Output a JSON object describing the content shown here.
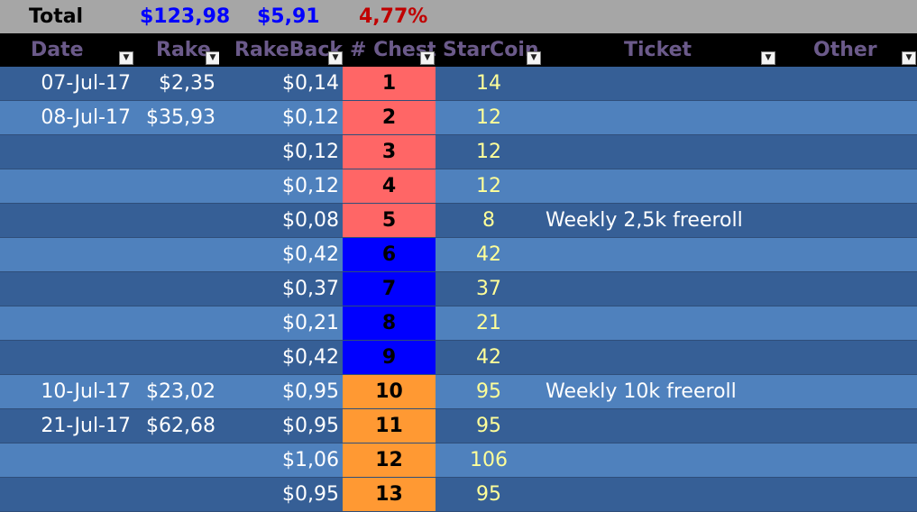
{
  "totals": {
    "label": "Total",
    "rake": "$123,98",
    "rakeback": "$5,91",
    "percent": "4,77%",
    "rake_color": "#0000ff",
    "rakeback_color": "#0000ff",
    "percent_color": "#c00000"
  },
  "columns": [
    {
      "key": "date",
      "label": "Date"
    },
    {
      "key": "rake",
      "label": "Rake"
    },
    {
      "key": "rakeback",
      "label": "RakeBack"
    },
    {
      "key": "chest",
      "label": "# Chest"
    },
    {
      "key": "starcoin",
      "label": "StarCoin"
    },
    {
      "key": "ticket",
      "label": "Ticket"
    },
    {
      "key": "other",
      "label": "Other"
    }
  ],
  "filter_icon": "dropdown-arrow-icon",
  "chest_colors": {
    "red": "#ff6666",
    "blue": "#0000ff",
    "orange": "#ff9933"
  },
  "rows": [
    {
      "date": "07-Jul-17",
      "rake": "$2,35",
      "rakeback": "$0,14",
      "chest": "1",
      "chest_color": "red",
      "starcoin": "14",
      "ticket": "",
      "other": ""
    },
    {
      "date": "08-Jul-17",
      "rake": "$35,93",
      "rakeback": "$0,12",
      "chest": "2",
      "chest_color": "red",
      "starcoin": "12",
      "ticket": "",
      "other": ""
    },
    {
      "date": "",
      "rake": "",
      "rakeback": "$0,12",
      "chest": "3",
      "chest_color": "red",
      "starcoin": "12",
      "ticket": "",
      "other": ""
    },
    {
      "date": "",
      "rake": "",
      "rakeback": "$0,12",
      "chest": "4",
      "chest_color": "red",
      "starcoin": "12",
      "ticket": "",
      "other": ""
    },
    {
      "date": "",
      "rake": "",
      "rakeback": "$0,08",
      "chest": "5",
      "chest_color": "red",
      "starcoin": "8",
      "ticket": "Weekly 2,5k freeroll",
      "other": ""
    },
    {
      "date": "",
      "rake": "",
      "rakeback": "$0,42",
      "chest": "6",
      "chest_color": "blue",
      "starcoin": "42",
      "ticket": "",
      "other": ""
    },
    {
      "date": "",
      "rake": "",
      "rakeback": "$0,37",
      "chest": "7",
      "chest_color": "blue",
      "starcoin": "37",
      "ticket": "",
      "other": ""
    },
    {
      "date": "",
      "rake": "",
      "rakeback": "$0,21",
      "chest": "8",
      "chest_color": "blue",
      "starcoin": "21",
      "ticket": "",
      "other": ""
    },
    {
      "date": "",
      "rake": "",
      "rakeback": "$0,42",
      "chest": "9",
      "chest_color": "blue",
      "starcoin": "42",
      "ticket": "",
      "other": ""
    },
    {
      "date": "10-Jul-17",
      "rake": "$23,02",
      "rakeback": "$0,95",
      "chest": "10",
      "chest_color": "orange",
      "starcoin": "95",
      "ticket": "Weekly 10k freeroll",
      "other": ""
    },
    {
      "date": "21-Jul-17",
      "rake": "$62,68",
      "rakeback": "$0,95",
      "chest": "11",
      "chest_color": "orange",
      "starcoin": "95",
      "ticket": "",
      "other": ""
    },
    {
      "date": "",
      "rake": "",
      "rakeback": "$1,06",
      "chest": "12",
      "chest_color": "orange",
      "starcoin": "106",
      "ticket": "",
      "other": ""
    },
    {
      "date": "",
      "rake": "",
      "rakeback": "$0,95",
      "chest": "13",
      "chest_color": "orange",
      "starcoin": "95",
      "ticket": "",
      "other": ""
    }
  ]
}
